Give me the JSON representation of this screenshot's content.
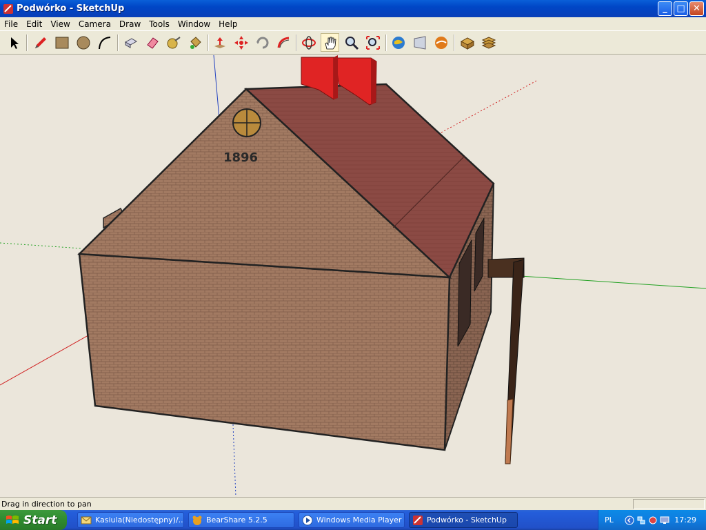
{
  "window": {
    "title": "Podwórko - SketchUp",
    "controls": {
      "minimize": "_",
      "maximize": "□",
      "close": "✕"
    }
  },
  "menu": [
    "File",
    "Edit",
    "View",
    "Camera",
    "Draw",
    "Tools",
    "Window",
    "Help"
  ],
  "toolbar": {
    "tools": [
      "select-icon",
      "pencil-icon",
      "rectangle-icon",
      "circle-icon",
      "arc-icon",
      "make-component-icon",
      "eraser-icon",
      "tape-measure-icon",
      "paint-bucket-icon",
      "push-pull-icon",
      "move-icon",
      "rotate-icon",
      "follow-me-icon",
      "orbit-icon",
      "pan-icon",
      "zoom-icon",
      "zoom-extents-icon",
      "get-models-icon",
      "share-model-icon",
      "send-to-google-earth-icon",
      "component-icon",
      "layers-icon"
    ],
    "active_tool": "pan-icon"
  },
  "model": {
    "gable_text": "1896",
    "colors": {
      "brick": "#a27a62",
      "roof": "#8b4a44",
      "chimney": "#e02424",
      "window_circle": "#b98a3c",
      "background": "#ebe6db"
    }
  },
  "statusbar": {
    "text": "Drag in direction to pan"
  },
  "taskbar": {
    "start_label": "Start",
    "tasks": [
      {
        "label": "Kasiula(Niedostępny)/...",
        "icon": "mail-icon"
      },
      {
        "label": "BearShare 5.2.5",
        "icon": "bearshare-icon"
      },
      {
        "label": "Windows Media Player",
        "icon": "media-player-icon"
      },
      {
        "label": "Podwórko - SketchUp",
        "icon": "sketchup-icon",
        "active": true
      }
    ],
    "tray": {
      "language": "PL",
      "clock": "17:29"
    }
  }
}
